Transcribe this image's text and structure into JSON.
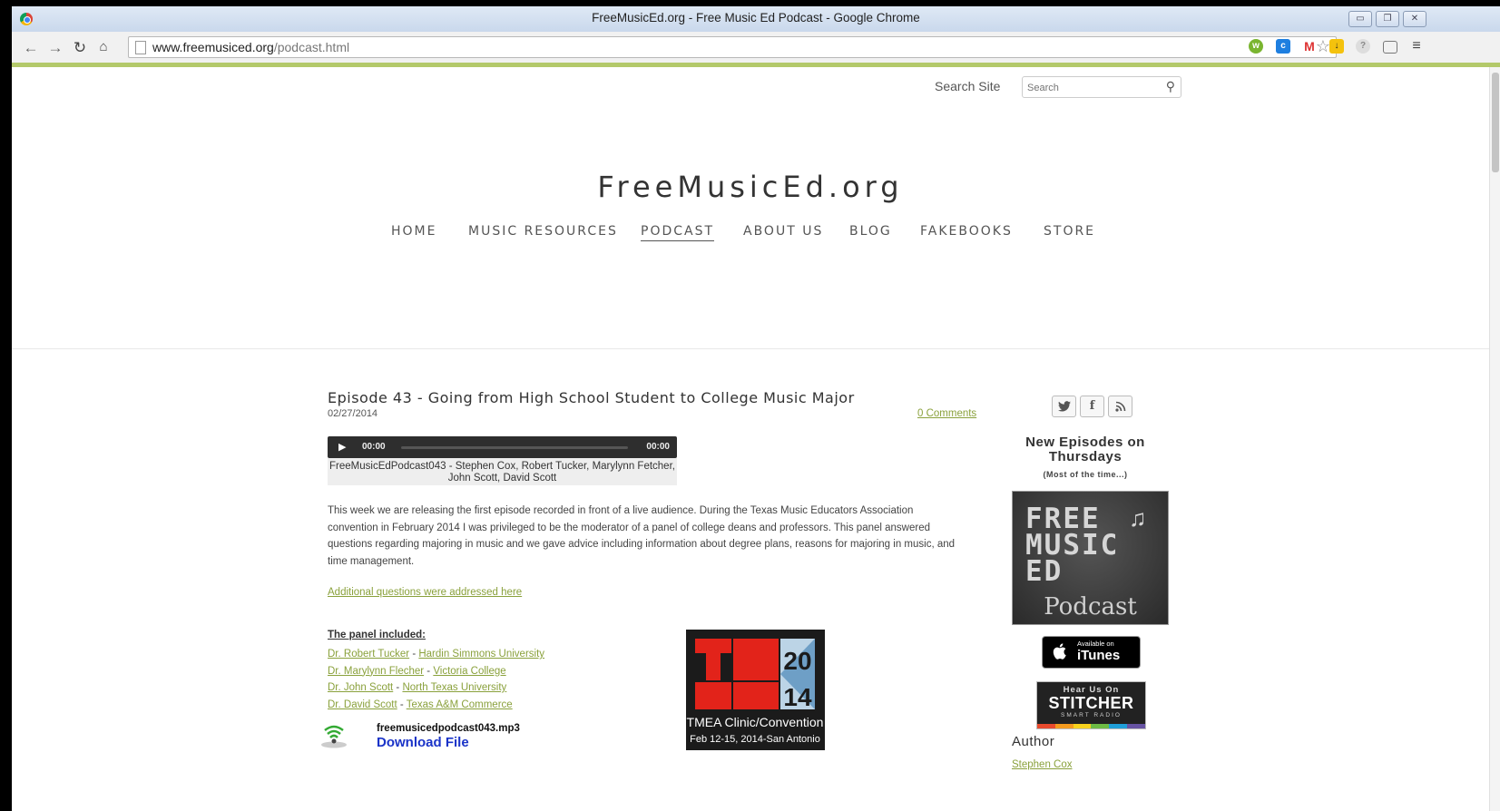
{
  "window": {
    "title": "FreeMusicEd.org - Free Music Ed Podcast - Google Chrome"
  },
  "browser": {
    "url_host": "www.freemusiced.org",
    "url_path": "/podcast.html"
  },
  "header": {
    "search_label": "Search Site",
    "search_placeholder": "Search",
    "site_title": "FreeMusicEd.org",
    "nav": [
      "HOME",
      "MUSIC RESOURCES",
      "PODCAST",
      "ABOUT US",
      "BLOG",
      "FAKEBOOKS",
      "STORE"
    ],
    "active_nav": "PODCAST"
  },
  "post": {
    "title": "Episode 43 - Going from High School Student to College Music Major",
    "date": "02/27/2014",
    "comments": "0 Comments",
    "player": {
      "current": "00:00",
      "duration": "00:00"
    },
    "caption": "FreeMusicEdPodcast043 - Stephen Cox, Robert Tucker, Marylynn Fetcher, John Scott, David Scott",
    "body": "This week we are releasing the first episode recorded in front of a live audience.  During the Texas Music Educators Association convention in February 2014 I was privileged to be the moderator of a panel of college deans and professors.  This panel answered questions regarding majoring in music and we gave advice including information about degree plans, reasons for majoring in music, and time management.",
    "more_link": "Additional questions were addressed here",
    "panel_heading": "The panel included:",
    "panel": [
      {
        "name": "Dr. Robert Tucker",
        "sep": " - ",
        "school": "Hardin Simmons University"
      },
      {
        "name": "Dr. Marylynn Flecher",
        "sep": " - ",
        "school": "Victoria College"
      },
      {
        "name": "Dr. John Scott",
        "sep": " - ",
        "school": "North Texas University"
      },
      {
        "name": "Dr. David Scott",
        "sep": " - ",
        "school": "Texas A&M Commerce"
      }
    ],
    "download": {
      "filename": "freemusicedpodcast043.mp3",
      "label": "Download File"
    },
    "tmea_image": {
      "year_top": "20",
      "year_bottom": "14",
      "line1": "TMEA Clinic/Convention",
      "line2": "Feb 12-15, 2014-San Antonio"
    }
  },
  "sidebar": {
    "social": [
      "twitter-icon",
      "facebook-icon",
      "rss-icon"
    ],
    "heading": "New Episodes on Thursdays",
    "subheading": "(Most of the time...)",
    "podcast_art": {
      "words": [
        "FREE",
        "MUSIC",
        "ED"
      ],
      "pod": "Podcast"
    },
    "itunes": {
      "small": "Available on",
      "big": "iTunes"
    },
    "stitcher": {
      "line1": "Hear Us On",
      "line2": "STITCHER",
      "line3": "SMART RADIO"
    },
    "author_heading": "Author",
    "author_name": "Stephen Cox"
  },
  "colors": {
    "accent": "#8aa13c",
    "greenbar": "#b3c96a",
    "download_link": "#1a33c8"
  }
}
